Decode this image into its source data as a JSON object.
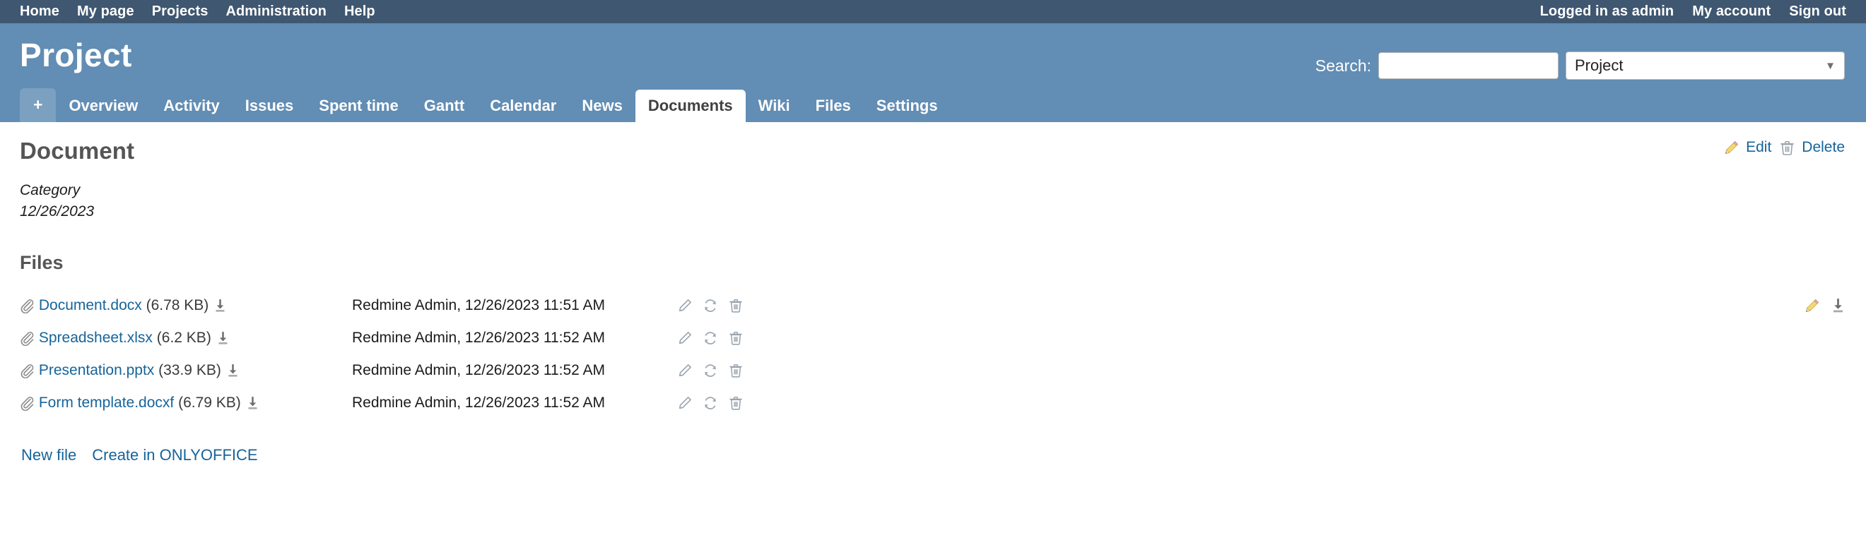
{
  "top_menu": {
    "left_items": [
      {
        "label": "Home"
      },
      {
        "label": "My page"
      },
      {
        "label": "Projects"
      },
      {
        "label": "Administration"
      },
      {
        "label": "Help"
      }
    ],
    "logged_in_prefix": "Logged in as ",
    "logged_in_user": "admin",
    "my_account": "My account",
    "sign_out": "Sign out"
  },
  "header": {
    "project_title": "Project",
    "search_label": "Search:",
    "search_value": "",
    "search_placeholder": "",
    "scope_selected": "Project"
  },
  "tabs": [
    {
      "label": "+",
      "selected": false
    },
    {
      "label": "Overview",
      "selected": false
    },
    {
      "label": "Activity",
      "selected": false
    },
    {
      "label": "Issues",
      "selected": false
    },
    {
      "label": "Spent time",
      "selected": false
    },
    {
      "label": "Gantt",
      "selected": false
    },
    {
      "label": "Calendar",
      "selected": false
    },
    {
      "label": "News",
      "selected": false
    },
    {
      "label": "Documents",
      "selected": true
    },
    {
      "label": "Wiki",
      "selected": false
    },
    {
      "label": "Files",
      "selected": false
    },
    {
      "label": "Settings",
      "selected": false
    }
  ],
  "contextual": {
    "edit": "Edit",
    "delete": "Delete"
  },
  "document": {
    "title": "Document",
    "category": "Category",
    "date": "12/26/2023",
    "files_heading": "Files"
  },
  "files": [
    {
      "name": "Document.docx",
      "size": "(6.78 KB)",
      "author": "Redmine Admin, 12/26/2023 11:51 AM",
      "has_row_actions": true
    },
    {
      "name": "Spreadsheet.xlsx",
      "size": "(6.2 KB)",
      "author": "Redmine Admin, 12/26/2023 11:52 AM",
      "has_row_actions": false
    },
    {
      "name": "Presentation.pptx",
      "size": "(33.9 KB)",
      "author": "Redmine Admin, 12/26/2023 11:52 AM",
      "has_row_actions": false
    },
    {
      "name": "Form template.docxf",
      "size": "(6.79 KB)",
      "author": "Redmine Admin, 12/26/2023 11:52 AM",
      "has_row_actions": false
    }
  ],
  "footer_actions": {
    "new_file": "New file",
    "create_onlyoffice": "Create in ONLYOFFICE"
  },
  "colors": {
    "topbar": "#3f5770",
    "header": "#628db4",
    "link": "#16649b",
    "tab_active_text": "#414141",
    "pencil_yellow": "#f2cf63",
    "icon_gray": "#9aa3ad"
  }
}
